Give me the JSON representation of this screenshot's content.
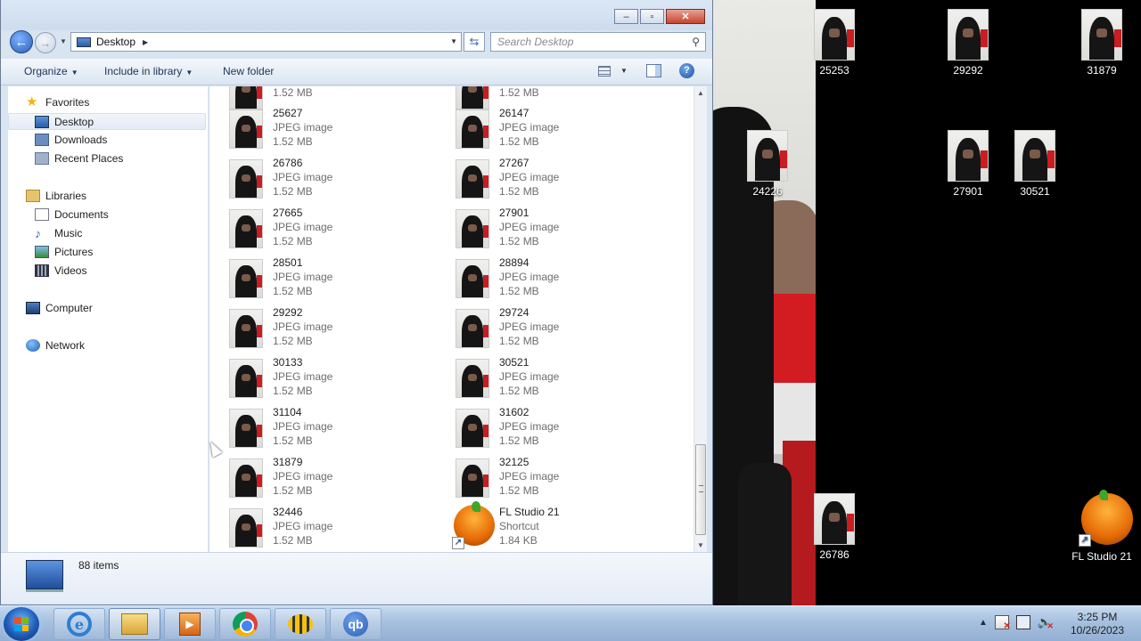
{
  "window": {
    "caption": {
      "minimize": "‒",
      "maximize": "▫",
      "close": "✕"
    },
    "address": {
      "crumb": "Desktop"
    },
    "search": {
      "placeholder": "Search Desktop"
    },
    "toolbar": {
      "organize": "Organize",
      "include_in_library": "Include in library",
      "new_folder": "New folder",
      "help": "?"
    },
    "navpane": {
      "favorites": "Favorites",
      "desktop": "Desktop",
      "downloads": "Downloads",
      "recent_places": "Recent Places",
      "libraries": "Libraries",
      "documents": "Documents",
      "music": "Music",
      "pictures": "Pictures",
      "videos": "Videos",
      "computer": "Computer",
      "network": "Network"
    },
    "files": {
      "partial_top_left": {
        "size": "1.52 MB"
      },
      "partial_top_right": {
        "size": "1.52 MB"
      },
      "left": [
        {
          "name": "25627",
          "type": "JPEG image",
          "size": "1.52 MB"
        },
        {
          "name": "26786",
          "type": "JPEG image",
          "size": "1.52 MB"
        },
        {
          "name": "27665",
          "type": "JPEG image",
          "size": "1.52 MB"
        },
        {
          "name": "28501",
          "type": "JPEG image",
          "size": "1.52 MB"
        },
        {
          "name": "29292",
          "type": "JPEG image",
          "size": "1.52 MB"
        },
        {
          "name": "30133",
          "type": "JPEG image",
          "size": "1.52 MB"
        },
        {
          "name": "31104",
          "type": "JPEG image",
          "size": "1.52 MB"
        },
        {
          "name": "31879",
          "type": "JPEG image",
          "size": "1.52 MB"
        },
        {
          "name": "32446",
          "type": "JPEG image",
          "size": "1.52 MB"
        }
      ],
      "right": [
        {
          "name": "26147",
          "type": "JPEG image",
          "size": "1.52 MB"
        },
        {
          "name": "27267",
          "type": "JPEG image",
          "size": "1.52 MB"
        },
        {
          "name": "27901",
          "type": "JPEG image",
          "size": "1.52 MB"
        },
        {
          "name": "28894",
          "type": "JPEG image",
          "size": "1.52 MB"
        },
        {
          "name": "29724",
          "type": "JPEG image",
          "size": "1.52 MB"
        },
        {
          "name": "30521",
          "type": "JPEG image",
          "size": "1.52 MB"
        },
        {
          "name": "31602",
          "type": "JPEG image",
          "size": "1.52 MB"
        },
        {
          "name": "32125",
          "type": "JPEG image",
          "size": "1.52 MB"
        },
        {
          "name": "FL Studio 21",
          "type": "Shortcut",
          "size": "1.84 KB"
        }
      ]
    },
    "status": {
      "item_count": "88 items"
    }
  },
  "desktop_icons": [
    {
      "label": "25253"
    },
    {
      "label": "29292"
    },
    {
      "label": "31879"
    },
    {
      "label": "24226"
    },
    {
      "label": "27901"
    },
    {
      "label": "30521"
    },
    {
      "label": "26786"
    },
    {
      "label": "FL Studio 21"
    }
  ],
  "taskbar": {
    "apps": [
      "internet-explorer",
      "windows-explorer",
      "windows-media-player",
      "google-chrome",
      "bee-app",
      "qbittorrent"
    ],
    "qb_label": "qb",
    "clock": {
      "time": "3:25 PM",
      "date": "10/26/2023"
    }
  }
}
